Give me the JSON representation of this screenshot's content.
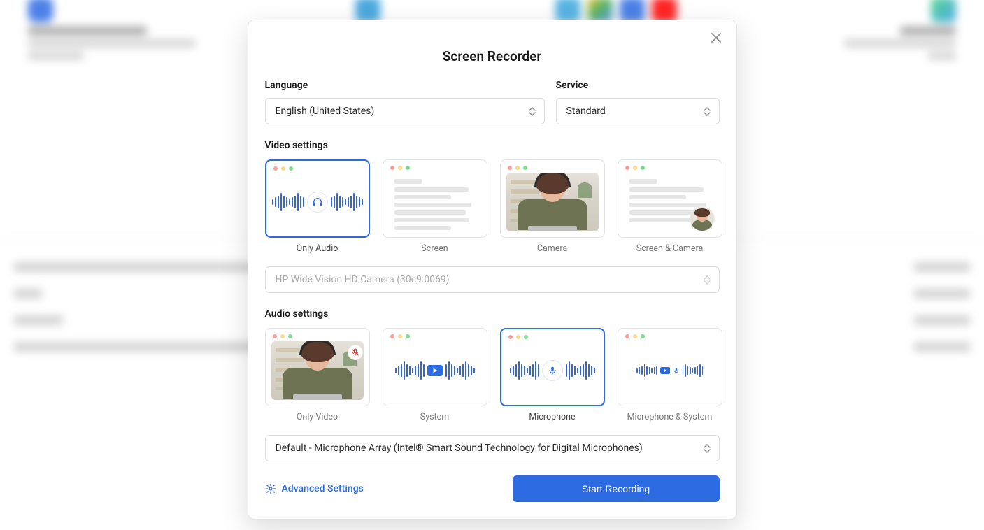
{
  "modal": {
    "title": "Screen Recorder",
    "language": {
      "label": "Language",
      "value": "English (United States)"
    },
    "service": {
      "label": "Service",
      "value": "Standard"
    },
    "video": {
      "label": "Video settings",
      "options": {
        "only_audio": "Only Audio",
        "screen": "Screen",
        "camera": "Camera",
        "screen_camera": "Screen & Camera"
      },
      "selected": "only_audio",
      "camera_device": "HP Wide Vision HD Camera (30c9:0069)"
    },
    "audio": {
      "label": "Audio settings",
      "options": {
        "only_video": "Only Video",
        "system": "System",
        "microphone": "Microphone",
        "mic_system": "Microphone & System"
      },
      "selected": "microphone",
      "mic_device": "Default - Microphone Array (Intel® Smart Sound Technology for Digital Microphones)"
    },
    "advanced_label": "Advanced Settings",
    "start_label": "Start Recording"
  }
}
